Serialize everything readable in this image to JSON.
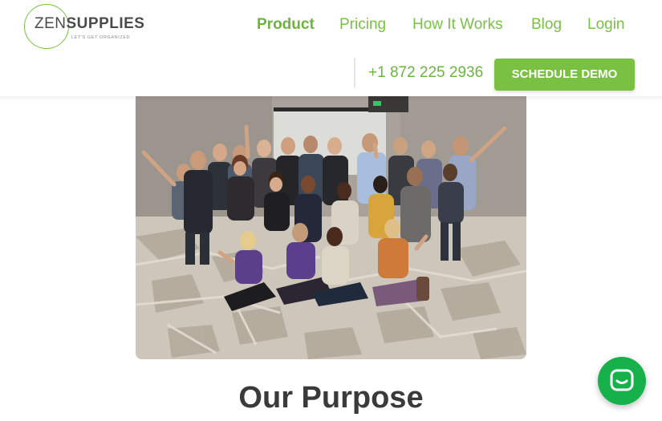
{
  "logo": {
    "prefix": "ZEN",
    "suffix": "SUPPLIES",
    "tagline": "LET'S GET ORGANIZED"
  },
  "nav": {
    "items": [
      {
        "label": "Product",
        "active": true
      },
      {
        "label": "Pricing",
        "active": false
      },
      {
        "label": "How It Works",
        "active": false
      },
      {
        "label": "Blog",
        "active": false
      },
      {
        "label": "Login",
        "active": false
      }
    ]
  },
  "contact": {
    "phone": "+1 872 225 2936",
    "cta_label": "SCHEDULE DEMO"
  },
  "hero": {
    "image_subject": "team group photo"
  },
  "section": {
    "title": "Our Purpose"
  },
  "chat": {
    "icon": "chat-bubble-icon"
  },
  "colors": {
    "brand_green": "#7ac143",
    "chat_green": "#16b14a",
    "heading": "#3a3a3a"
  }
}
